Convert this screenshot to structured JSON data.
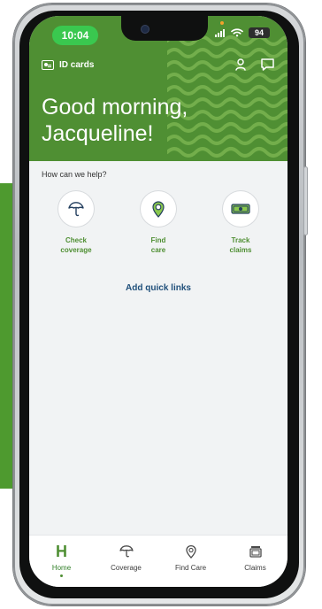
{
  "status": {
    "time": "10:04",
    "battery": "94"
  },
  "header": {
    "id_cards": "ID cards",
    "greeting_line_1": "Good morning,",
    "greeting_line_2": "Jacqueline!"
  },
  "main": {
    "help_title": "How can we help?",
    "quick_links": [
      {
        "label": "Check\ncoverage",
        "icon": "umbrella-icon"
      },
      {
        "label": "Find\ncare",
        "icon": "location-pin-icon"
      },
      {
        "label": "Track\nclaims",
        "icon": "money-icon"
      }
    ],
    "add_quick_links": "Add quick links"
  },
  "tabbar": {
    "items": [
      {
        "label": "Home",
        "icon": "home-icon"
      },
      {
        "label": "Coverage",
        "icon": "umbrella-icon"
      },
      {
        "label": "Find Care",
        "icon": "location-pin-icon"
      },
      {
        "label": "Claims",
        "icon": "claims-icon"
      }
    ]
  },
  "colors": {
    "brand_green": "#4f8f33",
    "status_green": "#3ac84f",
    "link_blue": "#1f4f7a",
    "background_green": "#4e9a2f"
  }
}
